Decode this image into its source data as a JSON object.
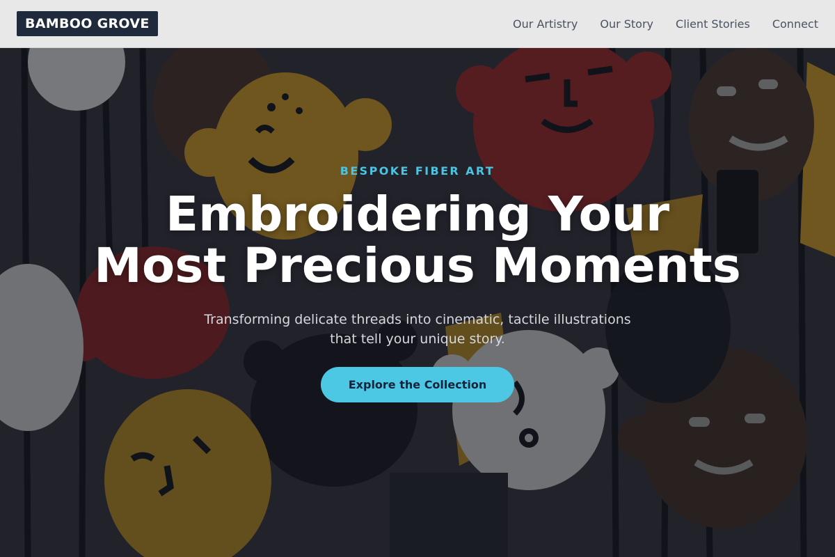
{
  "header": {
    "logo": "BAMBOO GROVE",
    "nav": [
      {
        "label": "Our Artistry"
      },
      {
        "label": "Our Story"
      },
      {
        "label": "Client Stories"
      },
      {
        "label": "Connect"
      }
    ]
  },
  "hero": {
    "eyebrow": "BESPOKE FIBER ART",
    "headline_line1": "Embroidering Your",
    "headline_line2": "Most Precious Moments",
    "subtitle_line1": "Transforming delicate threads into cinematic, tactile illustrations",
    "subtitle_line2": "that tell your unique story.",
    "cta_label": "Explore the Collection"
  },
  "colors": {
    "accent": "#4cc8e4",
    "logo_bg": "#1f2a3d",
    "header_bg": "#e8e8e8"
  }
}
